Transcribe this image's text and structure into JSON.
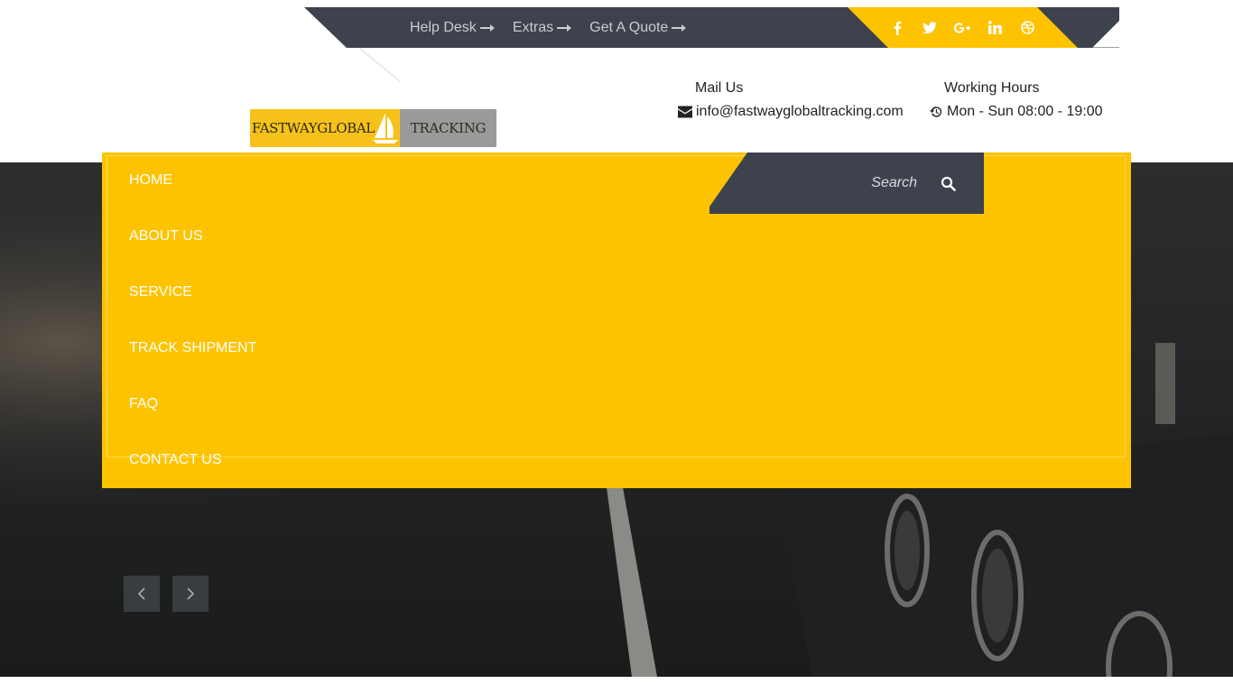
{
  "topbar": {
    "links": [
      {
        "label": "Help Desk"
      },
      {
        "label": "Extras"
      },
      {
        "label": "Get A Quote"
      }
    ],
    "social_icons": [
      "facebook-icon",
      "twitter-icon",
      "google-plus-icon",
      "linkedin-icon",
      "dribbble-icon"
    ]
  },
  "logo": {
    "left_text": "FASTWAYGLOBAL",
    "right_text": "TRACKING"
  },
  "contact": {
    "mail_title": "Mail Us",
    "mail_value": "info@fastwayglobaltracking.com",
    "hours_title": "Working Hours",
    "hours_value": "Mon - Sun 08:00 - 19:00"
  },
  "nav": {
    "items": [
      "HOME",
      "ABOUT US",
      "SERVICE",
      "TRACK SHIPMENT",
      "FAQ",
      "CONTACT US"
    ]
  },
  "search": {
    "placeholder": "Search"
  },
  "colors": {
    "accent_yellow": "#fec300",
    "dark_slate": "#3d424d",
    "white": "#ffffff"
  }
}
